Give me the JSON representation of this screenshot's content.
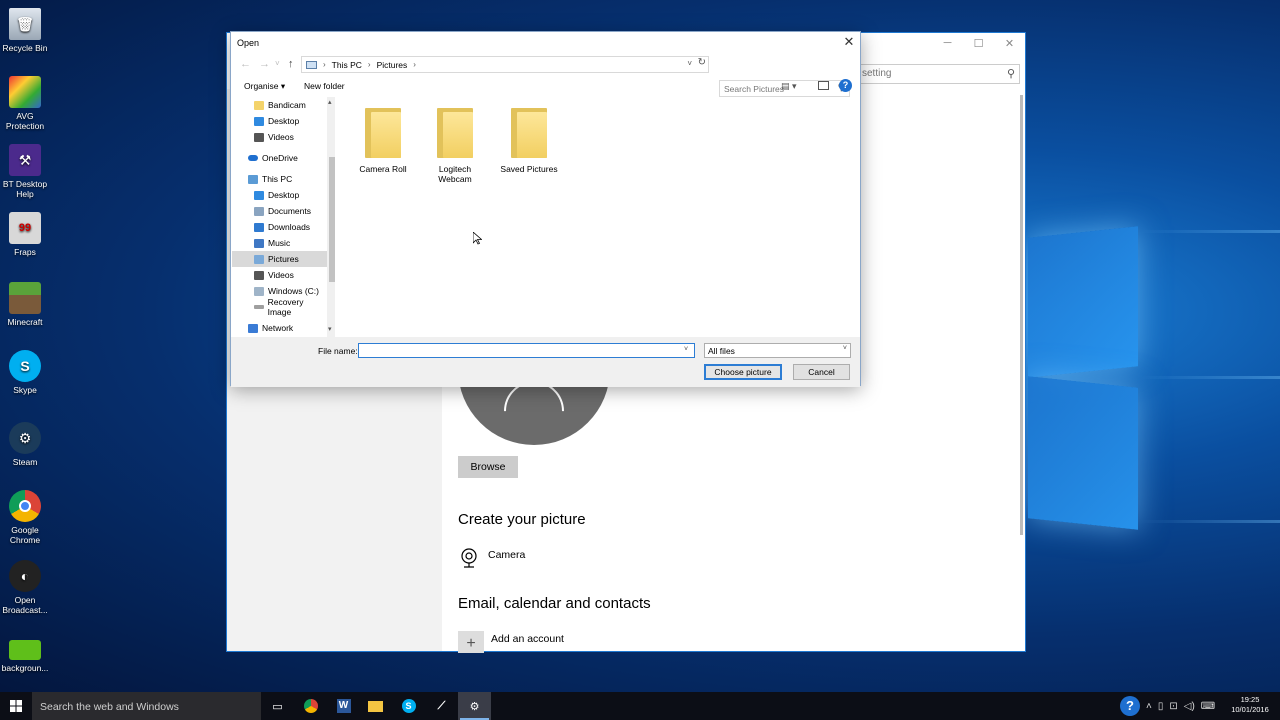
{
  "desktop": {
    "icons": [
      {
        "label": "Recycle Bin",
        "icon": "recycle-bin-icon"
      },
      {
        "label": "AVG Protection",
        "icon": "avg-icon"
      },
      {
        "label": "BT Desktop Help",
        "icon": "bt-icon"
      },
      {
        "label": "Fraps",
        "icon": "fraps-icon"
      },
      {
        "label": "Minecraft",
        "icon": "minecraft-icon"
      },
      {
        "label": "Skype",
        "icon": "skype-icon"
      },
      {
        "label": "Steam",
        "icon": "steam-icon"
      },
      {
        "label": "Google Chrome",
        "icon": "chrome-icon"
      },
      {
        "label": "Open Broadcast...",
        "icon": "obs-icon"
      },
      {
        "label": "backgroun...",
        "icon": "image-file-icon"
      }
    ]
  },
  "settings": {
    "search_placeholder": "setting",
    "browse_label": "Browse",
    "create_heading": "Create your picture",
    "camera_label": "Camera",
    "email_heading": "Email, calendar and contacts",
    "add_account_label": "Add an account"
  },
  "dialog": {
    "title": "Open",
    "breadcrumb": [
      "This PC",
      "Pictures"
    ],
    "search_placeholder": "Search Pictures",
    "organise_label": "Organise ▾",
    "new_folder_label": "New folder",
    "nav_items": [
      {
        "label": "Bandicam",
        "icon": "folder-icon",
        "color": "#f4d36a"
      },
      {
        "label": "Desktop",
        "icon": "desktop-icon",
        "color": "#2f8ae0"
      },
      {
        "label": "Videos",
        "icon": "videos-icon",
        "color": "#555555"
      },
      {
        "label": "OneDrive",
        "icon": "onedrive-icon",
        "color": "#1f6fcf"
      },
      {
        "label": "This PC",
        "icon": "this-pc-icon",
        "color": "#5b9bd5"
      },
      {
        "label": "Desktop",
        "icon": "desktop-icon",
        "color": "#2f8ae0"
      },
      {
        "label": "Documents",
        "icon": "documents-icon",
        "color": "#8aa4c0"
      },
      {
        "label": "Downloads",
        "icon": "downloads-icon",
        "color": "#2f7ad0"
      },
      {
        "label": "Music",
        "icon": "music-icon",
        "color": "#3f78c4"
      },
      {
        "label": "Pictures",
        "icon": "pictures-icon",
        "color": "#7aa9d8"
      },
      {
        "label": "Videos",
        "icon": "videos-icon",
        "color": "#555555"
      },
      {
        "label": "Windows (C:)",
        "icon": "drive-icon",
        "color": "#9fb4c8"
      },
      {
        "label": "Recovery Image",
        "icon": "drive-icon",
        "color": "#9f9f9f"
      },
      {
        "label": "Network",
        "icon": "network-icon",
        "color": "#3a7bd5"
      }
    ],
    "folders": [
      {
        "label": "Camera Roll"
      },
      {
        "label": "Logitech Webcam"
      },
      {
        "label": "Saved Pictures"
      }
    ],
    "file_name_label": "File name:",
    "file_name_value": "",
    "file_type_value": "All files",
    "choose_label": "Choose picture",
    "cancel_label": "Cancel"
  },
  "taskbar": {
    "search_placeholder": "Search the web and Windows",
    "time": "19:25",
    "date": "10/01/2016"
  }
}
